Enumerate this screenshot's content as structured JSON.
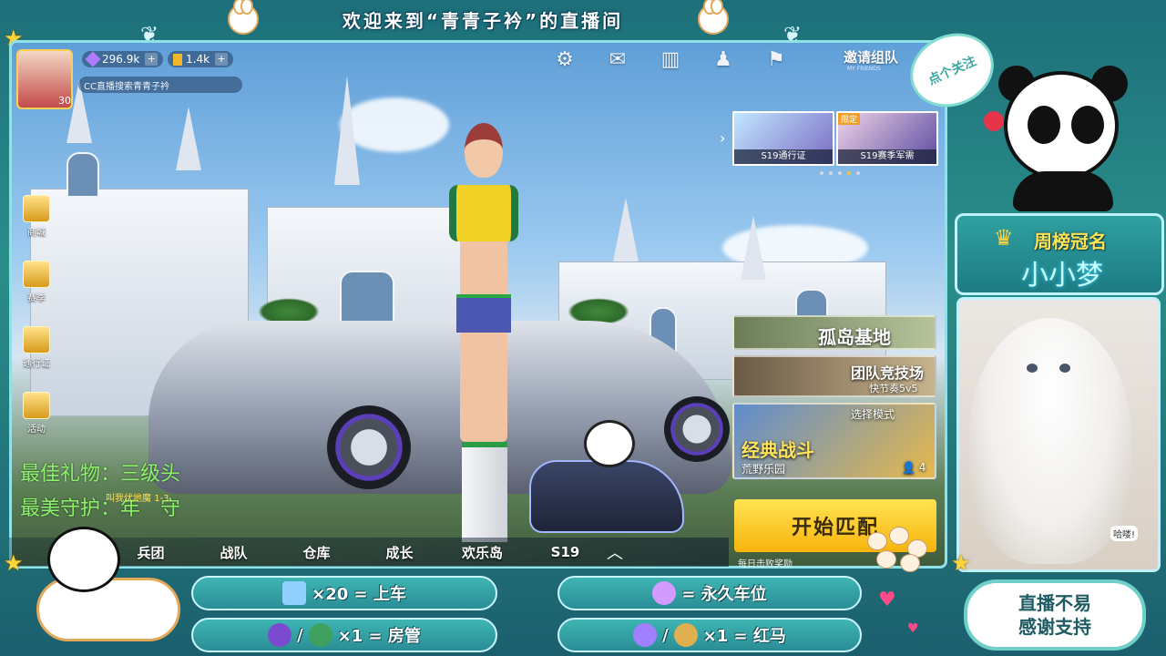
{
  "banner": {
    "title": "欢迎来到“青青子衿”的直播间"
  },
  "follow": {
    "label": "点个关注"
  },
  "hud": {
    "level": "30",
    "gems": "296.9k",
    "gold": "1.4k",
    "search_hint": "CC直播搜索青青子衿",
    "invite_label": "邀请组队",
    "invite_sub": "MY FRIENDS"
  },
  "left_menu": [
    {
      "label": "商城",
      "icon": "shop-icon"
    },
    {
      "label": "赛季",
      "icon": "season-icon"
    },
    {
      "label": "通行证",
      "icon": "pass-icon"
    },
    {
      "label": "活动",
      "icon": "event-icon"
    }
  ],
  "carousel": {
    "cards": [
      {
        "caption": "S19通行证",
        "tag": ""
      },
      {
        "caption": "S19赛季军需",
        "tag": "限定"
      }
    ],
    "active_index": 3,
    "dot_count": 5
  },
  "modes": {
    "island": "孤岛基地",
    "team": "团队竞技场",
    "team_sub": "快节奏5v5",
    "select": "选择模式",
    "classic": "经典战斗",
    "classic_map": "荒野乐园",
    "team_size": "4"
  },
  "start_button": "开始匹配",
  "daily": "每日击败奖励",
  "nav": [
    "兵团",
    "战队",
    "仓库",
    "成长",
    "欢乐岛",
    "S19"
  ],
  "overlay": {
    "best_gift": "最佳礼物：三级头",
    "best_guard": "最美守护：年　守",
    "hidden_tag": "叫我伏地魔",
    "hidden_num": "1-3"
  },
  "crown": {
    "title": "周榜冠名",
    "name": "小小梦"
  },
  "cat_cap": "哈喽!",
  "gifts": [
    {
      "text": "×20 = 上车"
    },
    {
      "text": "= 永久车位"
    },
    {
      "text": "×1 = 房管",
      "sep": "/"
    },
    {
      "text": "×1 = 红马",
      "sep": "/"
    }
  ],
  "thanks": {
    "line1": "直播不易",
    "line2": "感谢支持"
  },
  "colors": {
    "accent": "#8fe3e8",
    "start": "#f7b40c",
    "overlay_green": "#8ff06b"
  }
}
